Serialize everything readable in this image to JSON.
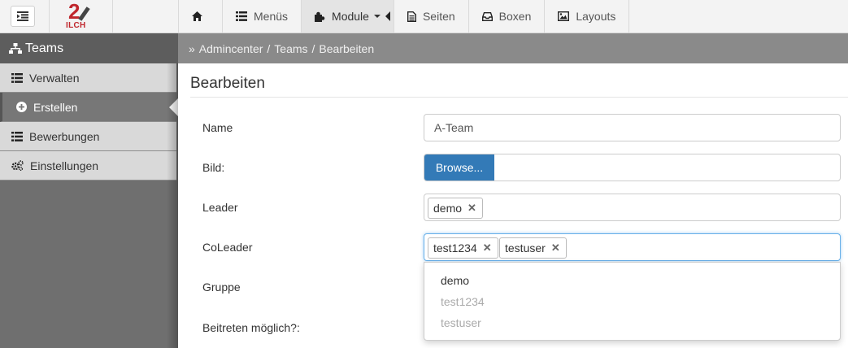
{
  "logo": {
    "number": "2",
    "text": "ILCH"
  },
  "nav": [
    {
      "label": "",
      "icon": "home-icon"
    },
    {
      "label": "Menüs",
      "icon": "list-icon"
    },
    {
      "label": "Module",
      "icon": "puzzle-icon"
    },
    {
      "label": "Seiten",
      "icon": "file-icon"
    },
    {
      "label": "Boxen",
      "icon": "inbox-icon"
    },
    {
      "label": "Layouts",
      "icon": "image-icon"
    }
  ],
  "sidebar": {
    "title": "Teams",
    "items": [
      {
        "label": "Verwalten",
        "icon": "list-icon"
      },
      {
        "label": "Erstellen",
        "icon": "plus-circle-icon"
      },
      {
        "label": "Bewerbungen",
        "icon": "list-icon"
      },
      {
        "label": "Einstellungen",
        "icon": "gears-icon"
      }
    ]
  },
  "breadcrumb": {
    "prefix": "»",
    "items": [
      "Admincenter",
      "Teams",
      "Bearbeiten"
    ],
    "separator": "/"
  },
  "page_title": "Bearbeiten",
  "form": {
    "name": {
      "label": "Name",
      "value": "A-Team"
    },
    "image": {
      "label": "Bild:",
      "button": "Browse..."
    },
    "leader": {
      "label": "Leader",
      "tags": [
        "demo"
      ]
    },
    "coleader": {
      "label": "CoLeader",
      "tags": [
        "test1234",
        "testuser"
      ]
    },
    "group": {
      "label": "Gruppe"
    },
    "join": {
      "label": "Beitreten möglich?:"
    }
  },
  "dropdown": {
    "options": [
      {
        "label": "demo",
        "disabled": false
      },
      {
        "label": "test1234",
        "disabled": true
      },
      {
        "label": "testuser",
        "disabled": true
      }
    ]
  },
  "colors": {
    "primary": "#337ab7",
    "logo_red": "#c0272d",
    "sidebar": "#6f6f6f",
    "breadcrumb": "#8a8a8a"
  }
}
